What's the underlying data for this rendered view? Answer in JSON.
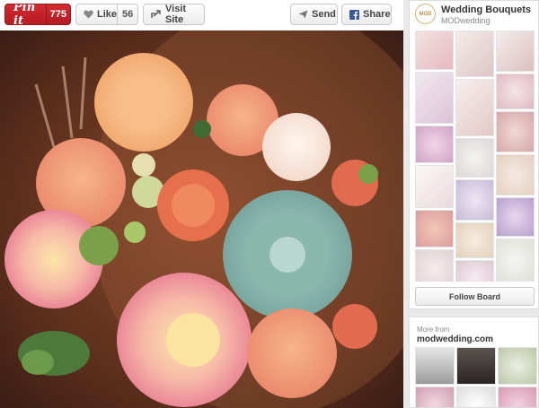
{
  "toolbar": {
    "pin_label": "Pin it",
    "pin_count": "775",
    "like_label": "Like",
    "like_count": "56",
    "visit_label": "Visit Site",
    "send_label": "Send",
    "share_label": "Share"
  },
  "board": {
    "avatar_text": "MOD",
    "title": "Wedding Bouquets",
    "owner": "MODwedding",
    "follow_label": "Follow Board"
  },
  "more": {
    "label": "More from",
    "site": "modwedding.com"
  },
  "colors": {
    "pinit_red": "#c9262c",
    "facebook_blue": "#3b5998"
  }
}
